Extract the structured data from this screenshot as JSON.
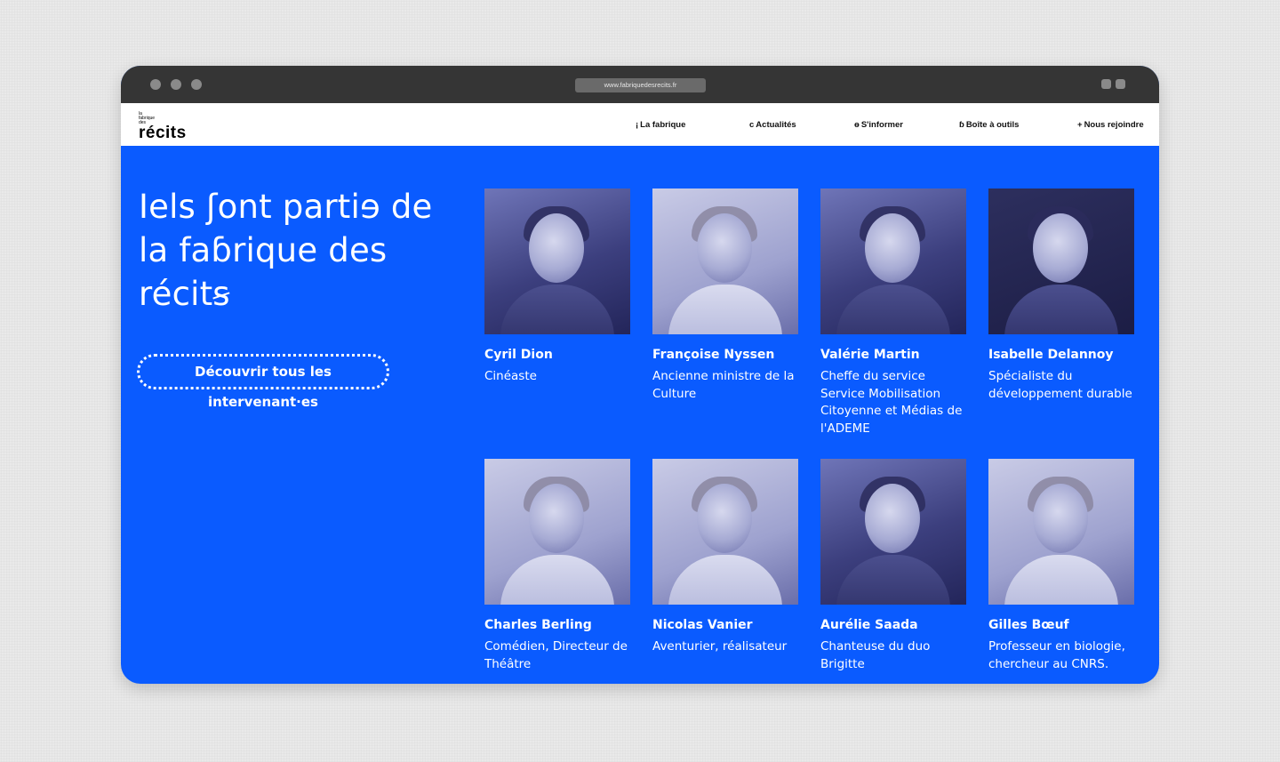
{
  "browser": {
    "url": "www.fabriquedesrecits.fr",
    "traffic_lights": [
      "close",
      "minimize",
      "maximize"
    ]
  },
  "nav": {
    "logo_small": [
      "la",
      "fabrique",
      "des"
    ],
    "logo_big": "récits",
    "items": [
      {
        "glyph": "¡",
        "label": "La fabrique"
      },
      {
        "glyph": "c",
        "label": "Actualités"
      },
      {
        "glyph": "ɵ",
        "label": "S'informer"
      },
      {
        "glyph": "ɓ",
        "label": "Boîte à outils"
      },
      {
        "glyph": "+",
        "label": "Nous rejoindre"
      }
    ]
  },
  "hero": {
    "title": "Iels ʃont partiɘ de la faɓrique des récitꞩ",
    "cta_label": "Découvrir tous les intervenant·es"
  },
  "people": [
    {
      "name": "Cyril Dion",
      "role": "Cinéaste"
    },
    {
      "name": "Françoise Nyssen",
      "role": "Ancienne ministre de la Culture"
    },
    {
      "name": "Valérie Martin",
      "role": "Cheffe du service Service Mobilisation Citoyenne et Médias de l'ADEME"
    },
    {
      "name": "Isabelle Delannoy",
      "role": "Spécialiste du développement durable"
    },
    {
      "name": "Charles Berling",
      "role": "Comédien, Directeur de Théâtre"
    },
    {
      "name": "Nicolas Vanier",
      "role": "Aventurier, réalisateur"
    },
    {
      "name": "Aurélie Saada",
      "role": "Chanteuse du duo Brigitte"
    },
    {
      "name": "Gilles Bœuf",
      "role": "Professeur en biologie, chercheur au CNRS."
    }
  ],
  "colors": {
    "page_bg": "#e9e9e9",
    "chrome": "#353535",
    "brand_blue": "#0a5bff",
    "text_on_blue": "#ffffff"
  }
}
